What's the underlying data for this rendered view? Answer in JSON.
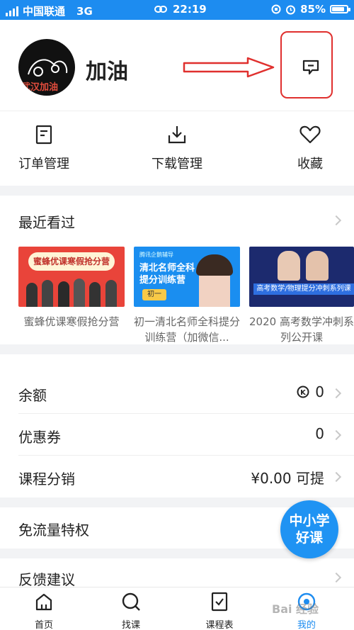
{
  "status_bar": {
    "carrier": "中国联通",
    "network": "3G",
    "time": "22:19",
    "battery": "85%",
    "battery_level": 0.85
  },
  "profile": {
    "avatar_text": "武汉加油",
    "username": "加油"
  },
  "quick_actions": [
    {
      "label": "订单管理",
      "icon": "order-icon"
    },
    {
      "label": "下载管理",
      "icon": "download-icon"
    },
    {
      "label": "收藏",
      "icon": "heart-icon"
    }
  ],
  "recent": {
    "title": "最近看过",
    "items": [
      {
        "thumb_text": "蜜蜂优课寒假抢分营",
        "thumb_sub": "寒假抢分营",
        "title": "蜜蜂优课寒假抢分营"
      },
      {
        "thumb_text": "清北名师全科提分训练营",
        "thumb_badge": "初一",
        "thumb_brand": "腾讯企鹅辅导",
        "title": "初一清北名师全科提分训练营（加微信..."
      },
      {
        "thumb_text": "高考数学/物理提分冲刺系列课",
        "title": "2020 高考数学冲刺系列公开课"
      }
    ]
  },
  "account": [
    {
      "label": "余额",
      "value": "0",
      "icon": "coin-icon"
    },
    {
      "label": "优惠券",
      "value": "0"
    },
    {
      "label": "课程分销",
      "value": "¥0.00 可提"
    }
  ],
  "flow": {
    "label": "免流量特权"
  },
  "feedback": {
    "label": "反馈建议"
  },
  "floating_badge": {
    "line1": "中小学",
    "line2": "好课"
  },
  "tabbar": [
    {
      "label": "首页",
      "icon": "home-icon"
    },
    {
      "label": "找课",
      "icon": "search-icon"
    },
    {
      "label": "课程表",
      "icon": "schedule-icon"
    },
    {
      "label": "我的",
      "icon": "profile-icon",
      "active": true
    }
  ],
  "watermark": "Bai 经验",
  "colors": {
    "accent": "#1d8cf0",
    "annotation": "#e0302e"
  }
}
